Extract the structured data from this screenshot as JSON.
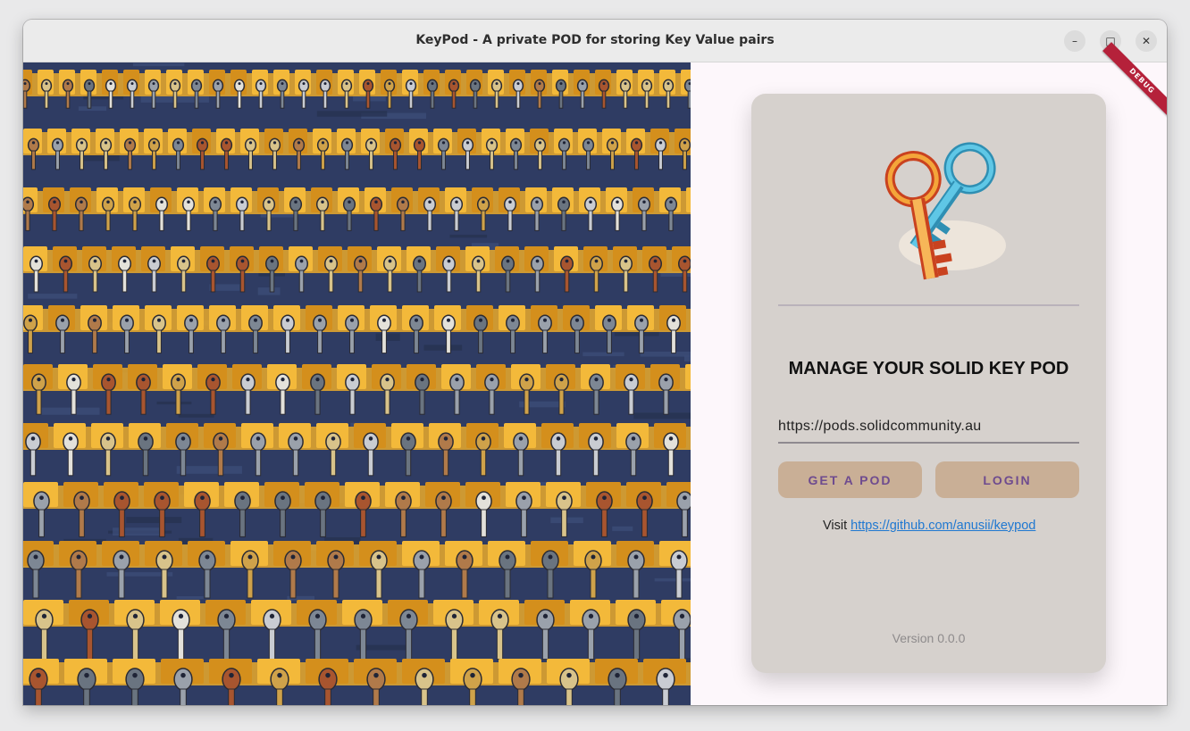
{
  "window": {
    "title": "KeyPod - A private POD for storing Key Value pairs",
    "minimize_glyph": "–",
    "maximize_glyph": "□",
    "close_glyph": "✕"
  },
  "debug_banner": "DEBUG",
  "hero_image": {
    "description_icon": "keys-wall-painting"
  },
  "card": {
    "logo_icon": "keys-logo-icon",
    "heading": "MANAGE YOUR SOLID KEY POD",
    "server_url": "https://pods.solidcommunity.au",
    "get_pod_label": "GET A POD",
    "login_label": "LOGIN",
    "visit_prefix": "Visit ",
    "repo_link": "https://github.com/anusii/keypod",
    "version": "Version 0.0.0"
  },
  "colors": {
    "card_bg": "#d6d1cd",
    "button_bg": "#c9af96",
    "button_text": "#6e4b8f",
    "link": "#1f78d1",
    "debug": "#b5213a"
  }
}
